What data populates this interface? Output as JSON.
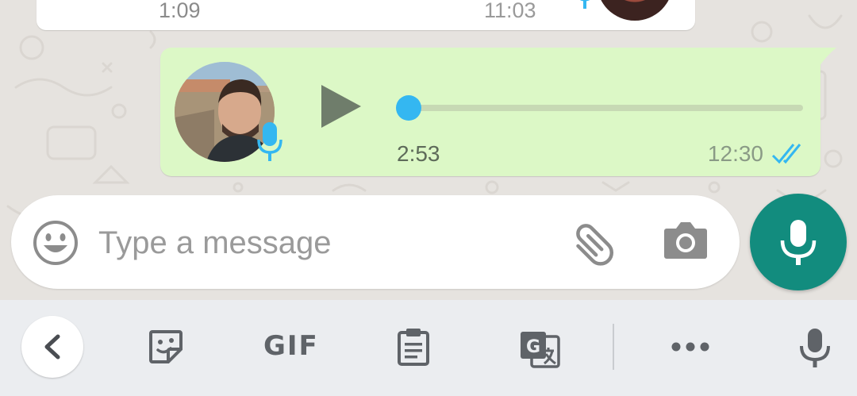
{
  "prev_message": {
    "duration": "1:09",
    "time": "11:03"
  },
  "voice_message": {
    "duration": "2:53",
    "time": "12:30",
    "progress": 0,
    "status": "read",
    "colors": {
      "bubble": "#DCF8C6",
      "thumb": "#34B7F1",
      "ticks": "#34B7F1"
    }
  },
  "composer": {
    "placeholder": "Type a message",
    "value": ""
  },
  "toolbar": {
    "gif_label": "GIF",
    "icons": [
      "chevron-left-icon",
      "sticker-icon",
      "gif",
      "clipboard-icon",
      "translate-icon",
      "more-icon",
      "mic-icon"
    ]
  },
  "colors": {
    "accent": "#128C7E"
  }
}
